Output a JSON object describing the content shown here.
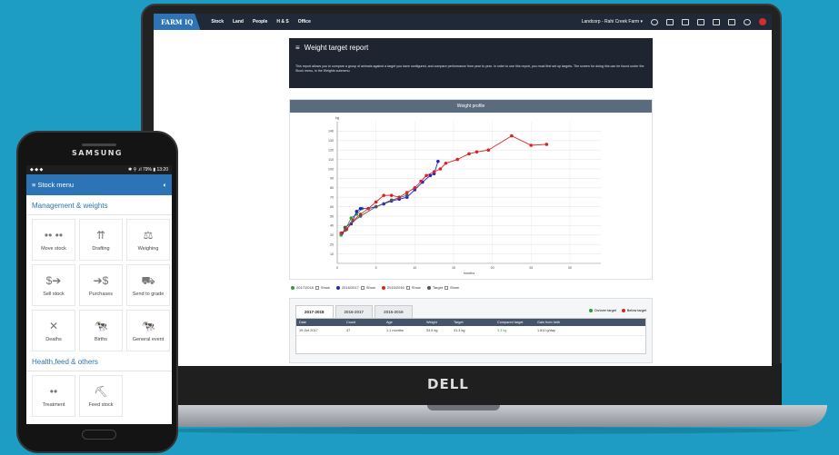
{
  "app": {
    "logo": "FARM IQ",
    "nav_links": [
      "Stock",
      "Land",
      "People",
      "H & S",
      "Office"
    ],
    "account": "Landcorp - Rahi Creek Farm ▾"
  },
  "report": {
    "title": "Weight target report",
    "description": "This report allows you to compare a group of animals against a target you have configured, and compare performance from year to year. In order to use this report, you must first set up targets. The screen for doing this can be found under the Stock menu, in the Weights submenu."
  },
  "chart_data": {
    "type": "line",
    "title": "Weight profile",
    "xlabel": "months",
    "ylabel": "kg",
    "xlim": [
      0,
      34
    ],
    "ylim": [
      0,
      150
    ],
    "x_ticks": [
      0,
      5,
      10,
      15,
      20,
      25,
      30
    ],
    "y_ticks": [
      10,
      20,
      30,
      40,
      50,
      60,
      70,
      80,
      90,
      100,
      110,
      120,
      130,
      140
    ],
    "grid": true,
    "series": [
      {
        "name": "2017/2018",
        "color": "#2e9d3c",
        "x": [
          0.5,
          1,
          1.8,
          2.5,
          3.2
        ],
        "y": [
          30,
          35,
          48,
          52,
          58
        ]
      },
      {
        "name": "2016/2017",
        "color": "#2222cc",
        "x": [
          0.6,
          1.2,
          1.8,
          2.5,
          3,
          4,
          5,
          6,
          7,
          8,
          9,
          10,
          11,
          12,
          12.5,
          13
        ],
        "y": [
          32,
          36,
          42,
          55,
          58,
          58,
          60,
          63,
          66,
          68,
          70,
          78,
          86,
          93,
          95,
          108
        ]
      },
      {
        "name": "2015/2016",
        "color": "#dd2222",
        "x": [
          0.5,
          1.2,
          2,
          3,
          4,
          5,
          6,
          7,
          8,
          9,
          10,
          10.8,
          11.5,
          12.5,
          13.3,
          14,
          15.5,
          17,
          18,
          19.5,
          22.5,
          25,
          27
        ],
        "y": [
          32,
          36,
          45,
          52,
          58,
          65,
          72,
          72,
          70,
          75,
          80,
          87,
          93,
          97,
          100,
          106,
          110,
          116,
          118,
          120,
          135,
          125,
          126
        ]
      },
      {
        "name": "Target",
        "color": "#555555",
        "x": [
          1,
          3,
          5,
          7,
          9
        ],
        "y": [
          38,
          50,
          60,
          67,
          72
        ]
      }
    ],
    "legend_show_label": "Show",
    "legend_placement": "bottom-left"
  },
  "tabs": [
    "2017-2018",
    "2016-2017",
    "2015-2016"
  ],
  "target_legend": {
    "on_over": "On/over target",
    "below": "Below target",
    "on_color": "#2e9d3c",
    "below_color": "#dd2222"
  },
  "table": {
    "headers": [
      "Date",
      "Count",
      "Age",
      "Weight",
      "Target",
      "Compared target",
      "Gain from birth"
    ],
    "rows": [
      [
        "19 Oct 2017",
        "37",
        "1.1 months",
        "34.5 kg",
        "31.3 kg",
        "3.3 kg",
        "1.810 g/day"
      ]
    ]
  },
  "phone": {
    "brand": "SAMSUNG",
    "status_left": "◆ ◆ ◆",
    "status_right": "✱ ⚲ .ıl 79% ▮ 13:20",
    "menu_title": "Stock menu",
    "sections": [
      {
        "title": "Management & weights",
        "items": [
          {
            "label": "Move stock",
            "icon": "••\n••"
          },
          {
            "label": "Drafting",
            "icon": "⇈"
          },
          {
            "label": "Weighing",
            "icon": "⚖"
          },
          {
            "label": "Sell stock",
            "icon": "$➔"
          },
          {
            "label": "Purchases",
            "icon": "➔$"
          },
          {
            "label": "Send to grade",
            "icon": "⛟"
          },
          {
            "label": "Deaths",
            "icon": "✕"
          },
          {
            "label": "Births",
            "icon": "🐄"
          },
          {
            "label": "General event",
            "icon": "🐄"
          }
        ]
      },
      {
        "title": "Health,feed & others",
        "items": [
          {
            "label": "Treatment",
            "icon": "••"
          },
          {
            "label": "Feed stock",
            "icon": "⛏"
          }
        ]
      }
    ]
  },
  "laptop_brand": "DELL"
}
